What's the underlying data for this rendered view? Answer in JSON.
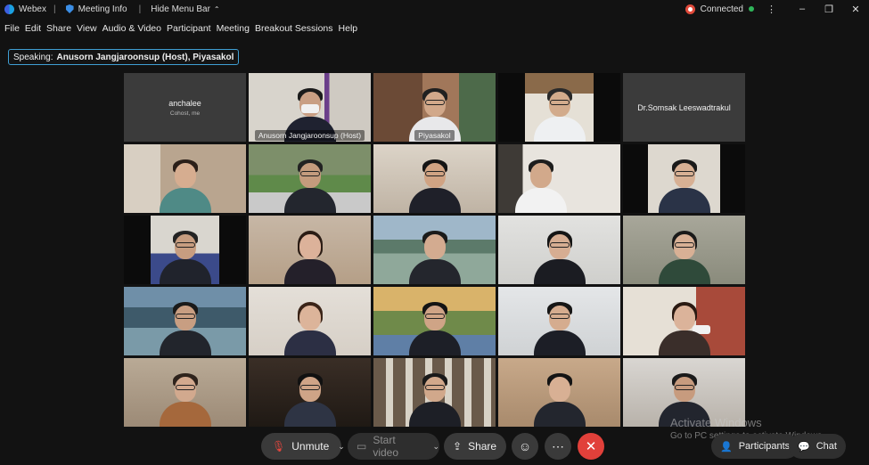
{
  "titlebar": {
    "app_name": "Webex",
    "meeting_info": "Meeting Info",
    "hide_menu": "Hide Menu Bar",
    "status": "Connected",
    "more": "⋮",
    "minimize": "–",
    "restore": "❐",
    "close": "✕"
  },
  "menu": [
    "File",
    "Edit",
    "Share",
    "View",
    "Audio & Video",
    "Participant",
    "Meeting",
    "Breakout Sessions",
    "Help"
  ],
  "speaking": {
    "label": "Speaking:",
    "names": "Anusorn Jangjaroonsup (Host), Piyasakol"
  },
  "tiles": {
    "t1": {
      "name": "anchalee",
      "sub": "Cohost, me"
    },
    "t2": {
      "name": "Anusorn Jangjaroonsup  (Host)"
    },
    "t3": {
      "name": "Piyasakol"
    },
    "t5": {
      "name": "Dr.Somsak Leeswadtrakul"
    }
  },
  "controls": {
    "unmute": "Unmute",
    "start_video": "Start video",
    "share": "Share",
    "participants": "Participants",
    "chat": "Chat"
  },
  "watermark": {
    "line1": "Activate Windows",
    "line2": "Go to PC settings to activate Windows."
  },
  "colors": {
    "active_border": "#1fa3d8",
    "end_button": "#e1403a",
    "connected_dot": "#2fb55a"
  }
}
